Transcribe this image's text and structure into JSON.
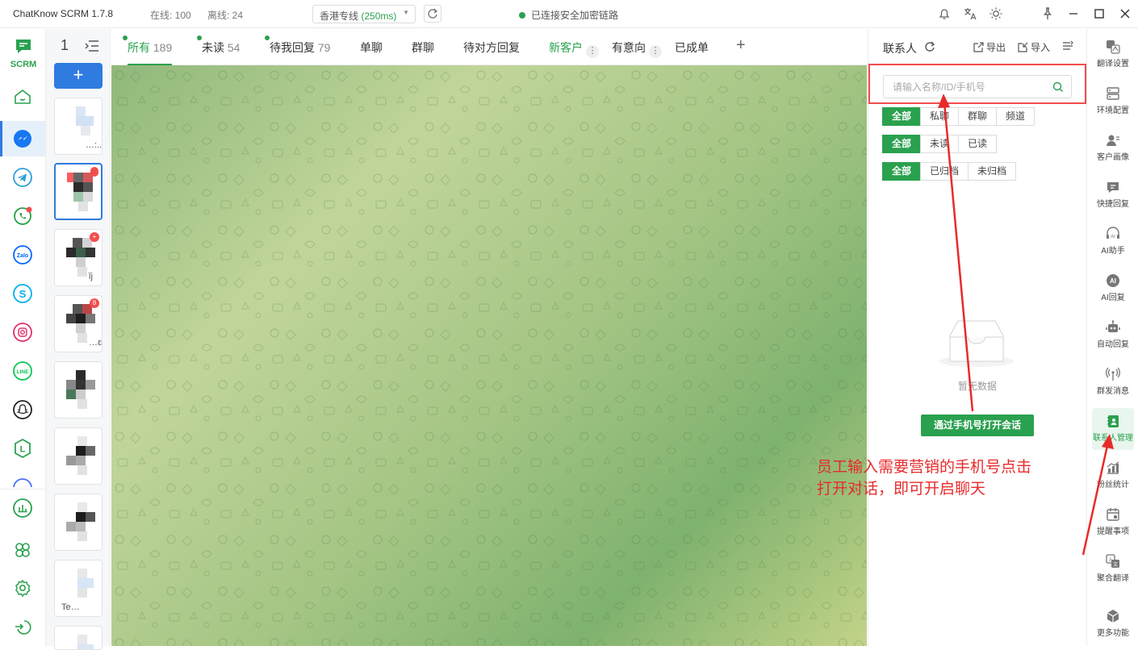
{
  "titlebar": {
    "app_title": "ChatKnow SCRM 1.7.8",
    "online": "在线: 100",
    "offline": "离线: 24",
    "line_name": "香港专线",
    "line_latency": "(250ms)",
    "status": "已连接安全加密链路",
    "icons": [
      "bell-icon",
      "translate-icon",
      "sun-icon",
      "pin-icon",
      "minimize-icon",
      "maximize-icon",
      "close-icon"
    ]
  },
  "sidebar": {
    "logo_text": "SCRM",
    "items": [
      {
        "name": "home",
        "icon": "home-icon"
      },
      {
        "name": "messenger",
        "icon": "messenger-icon",
        "active": true
      },
      {
        "name": "telegram",
        "icon": "telegram-icon"
      },
      {
        "name": "whatsapp",
        "icon": "whatsapp-icon",
        "dot": true
      },
      {
        "name": "zalo",
        "icon": "zalo-icon",
        "label": "Zalo"
      },
      {
        "name": "skype",
        "icon": "skype-icon",
        "label": "S"
      },
      {
        "name": "instagram",
        "icon": "instagram-icon"
      },
      {
        "name": "line",
        "icon": "line-icon",
        "label": "LINE"
      },
      {
        "name": "snapchat",
        "icon": "snapchat-icon"
      },
      {
        "name": "letter-l",
        "icon": "letter-l-icon",
        "label": "L"
      }
    ],
    "bottom": [
      {
        "name": "stats",
        "icon": "bar-chart-icon"
      },
      {
        "name": "apps",
        "icon": "clover-icon"
      },
      {
        "name": "settings",
        "icon": "gear-icon"
      },
      {
        "name": "logout",
        "icon": "logout-icon"
      }
    ]
  },
  "contacts": {
    "header_count": "1",
    "cards": [
      {
        "label": "…:..",
        "badge": ""
      },
      {
        "label": "",
        "badge": "",
        "active": true
      },
      {
        "label": "ǐj",
        "badge": "+"
      },
      {
        "label": "…ɛ",
        "badge": "8"
      },
      {
        "label": "",
        "badge": ""
      },
      {
        "label": "",
        "badge": ""
      },
      {
        "label": "",
        "badge": ""
      },
      {
        "label": "Te…",
        "badge": ""
      }
    ]
  },
  "tabs": [
    {
      "label": "所有",
      "count": "189",
      "active": true,
      "dot": true
    },
    {
      "label": "未读",
      "count": "54",
      "dot": true
    },
    {
      "label": "待我回复",
      "count": "79",
      "dot": true
    },
    {
      "label": "单聊",
      "count": ""
    },
    {
      "label": "群聊",
      "count": ""
    },
    {
      "label": "待对方回复",
      "count": ""
    },
    {
      "label": "新客户",
      "count": "",
      "green": true,
      "kebab": true
    },
    {
      "label": "有意向",
      "count": "",
      "kebab": true
    },
    {
      "label": "已成单",
      "count": ""
    }
  ],
  "contacts_panel": {
    "title": "联系人",
    "export_label": "导出",
    "import_label": "导入",
    "search_placeholder": "请输入名称/ID/手机号",
    "filter_type": [
      "全部",
      "私聊",
      "群聊",
      "频道"
    ],
    "filter_read": [
      "全部",
      "未读",
      "已读"
    ],
    "filter_archive": [
      "全部",
      "已归档",
      "未归档"
    ],
    "empty_text": "暂无数据",
    "open_button": "通过手机号打开会话"
  },
  "annotation": {
    "line1": "员工输入需要营销的手机号点击",
    "line2": "打开对话，即可开启聊天",
    "color": "#e82a2a"
  },
  "tools": [
    {
      "label": "翻译设置",
      "icon": "translate-settings-icon"
    },
    {
      "label": "环境配置",
      "icon": "server-icon"
    },
    {
      "label": "客户画像",
      "icon": "user-profile-icon"
    },
    {
      "label": "快捷回复",
      "icon": "quick-reply-icon"
    },
    {
      "label": "AI助手",
      "icon": "ai-headset-icon"
    },
    {
      "label": "AI回复",
      "icon": "ai-reply-icon"
    },
    {
      "label": "自动回复",
      "icon": "robot-icon"
    },
    {
      "label": "群发消息",
      "icon": "broadcast-icon"
    },
    {
      "label": "联系人管理",
      "icon": "contacts-book-icon",
      "active": true
    },
    {
      "label": "粉丝统计",
      "icon": "fans-stats-icon"
    },
    {
      "label": "提醒事项",
      "icon": "calendar-icon"
    },
    {
      "label": "聚合翻译",
      "icon": "aggregate-translate-icon"
    },
    {
      "label": "更多功能",
      "icon": "cube-icon"
    }
  ],
  "colors": {
    "accent_green": "#2aa14f",
    "accent_blue": "#2f7be0",
    "annotation_red": "#e82a2a"
  }
}
